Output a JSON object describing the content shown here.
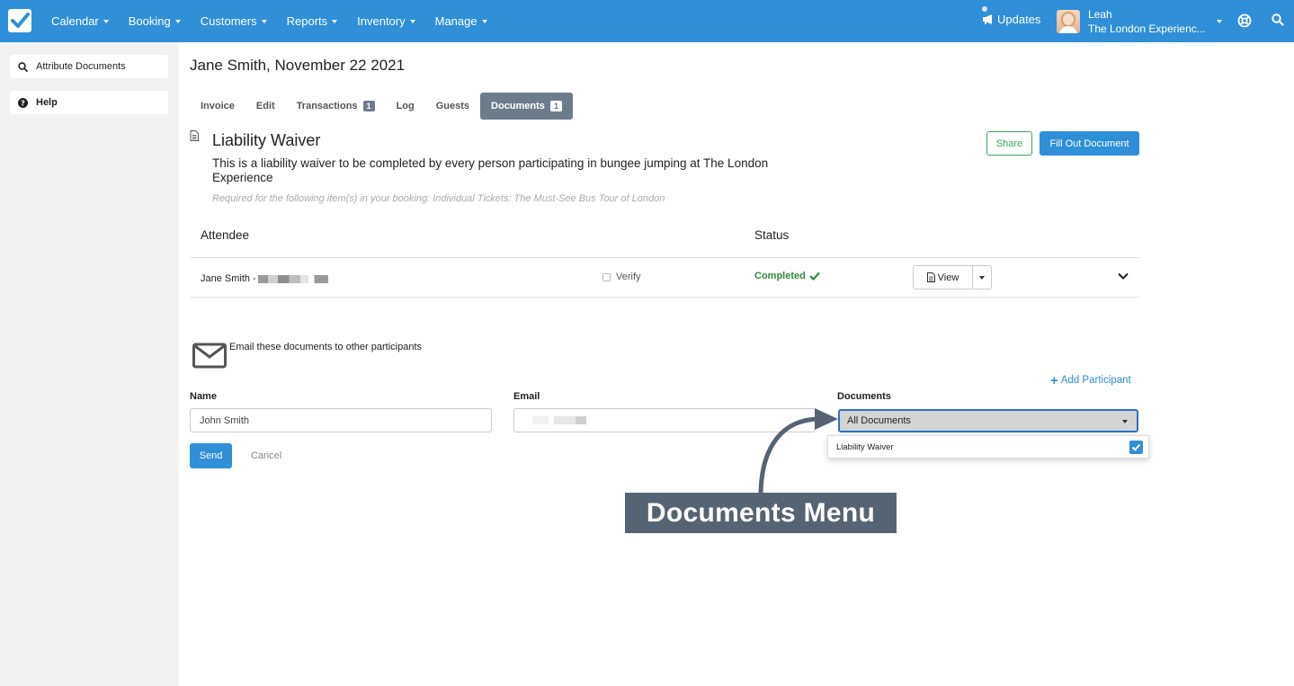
{
  "nav": {
    "menu": [
      {
        "label": "Calendar"
      },
      {
        "label": "Booking"
      },
      {
        "label": "Customers"
      },
      {
        "label": "Reports"
      },
      {
        "label": "Inventory"
      },
      {
        "label": "Manage"
      }
    ],
    "updates_label": "Updates",
    "user_name": "Leah",
    "user_company": "The London Experienc...",
    "accent": "#2f8fd8"
  },
  "sidebar": {
    "items": [
      {
        "label": "Attribute Documents",
        "icon": "search-icon"
      },
      {
        "label": "Help",
        "icon": "question-circle-icon"
      }
    ]
  },
  "page": {
    "title": "Jane Smith, November 22 2021",
    "tabs": [
      {
        "label": "Invoice"
      },
      {
        "label": "Edit"
      },
      {
        "label": "Transactions",
        "badge": "1"
      },
      {
        "label": "Log"
      },
      {
        "label": "Guests"
      },
      {
        "label": "Documents",
        "badge": "1",
        "active": true
      }
    ]
  },
  "document": {
    "title": "Liability Waiver",
    "description": "This is a liability waiver to be completed by every person participating in bungee jumping at The London Experience",
    "required_note": "Required for the following item(s) in your booking: Individual Tickets: The Must-See Bus Tour of London",
    "share_label": "Share",
    "fill_label": "Fill Out Document"
  },
  "attendees": {
    "headers": {
      "attendee": "Attendee",
      "status": "Status"
    },
    "rows": [
      {
        "name": "Jane Smith - ",
        "verify_label": "Verify",
        "status": "Completed",
        "view_label": "View"
      }
    ]
  },
  "email_form": {
    "intro": "Email these documents to other participants",
    "add_participant": "Add Participant",
    "name_label": "Name",
    "email_label": "Email",
    "documents_label": "Documents",
    "name_value": "John Smith",
    "documents_selected": "All Documents",
    "dropdown_options": [
      {
        "label": "Liability Waiver",
        "checked": true
      }
    ],
    "send_label": "Send",
    "cancel_label": "Cancel"
  },
  "annotation": {
    "label": "Documents Menu"
  }
}
